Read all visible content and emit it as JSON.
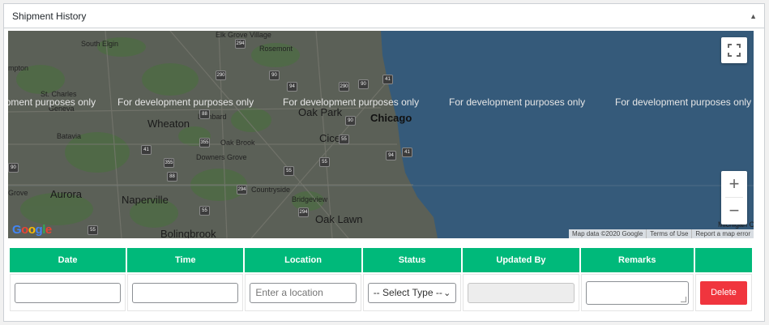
{
  "panel": {
    "title": "Shipment History",
    "toggle_icon": "arrow-up-icon"
  },
  "map": {
    "dev_watermark": "For development purposes only",
    "places": {
      "elk_grove_village": "Elk Grove Village",
      "rosemont": "Rosemont",
      "south_elgin": "South Elgin",
      "hampton": "mpton",
      "st_charles": "St. Charles",
      "geneva": "Geneva",
      "wheaton": "Wheaton",
      "lombard": "Lombard",
      "oak_park": "Oak Park",
      "chicago": "Chicago",
      "cicero": "Cicero",
      "batavia": "Batavia",
      "oak_brook": "Oak Brook",
      "downers_grove": "Downers Grove",
      "countryside": "Countryside",
      "grove": "Grove",
      "aurora": "Aurora",
      "naperville": "Naperville",
      "bridgeview": "Bridgeview",
      "oak_lawn": "Oak Lawn",
      "bolingbrook": "Bolingbrook",
      "michigan_c": "Michigan C"
    },
    "shields": [
      "290",
      "294",
      "90",
      "41",
      "90",
      "290",
      "94",
      "355",
      "88",
      "55",
      "41",
      "94",
      "90",
      "55",
      "55",
      "294",
      "294",
      "355",
      "55",
      "55",
      "41",
      "88",
      "90"
    ],
    "attribution": {
      "map_data": "Map data ©2020 Google",
      "terms": "Terms of Use",
      "report": "Report a map error"
    },
    "google_logo": "Google",
    "controls": {
      "zoom_in": "+",
      "zoom_out": "−"
    }
  },
  "table": {
    "headers": [
      "Date",
      "Time",
      "Location",
      "Status",
      "Updated By",
      "Remarks",
      ""
    ],
    "row": {
      "date": "",
      "time": "",
      "location_placeholder": "Enter a location",
      "status_selected": "-- Select Type --",
      "updated_by": "",
      "remarks": "",
      "delete_label": "Delete"
    }
  },
  "colors": {
    "header_green": "#00b97a",
    "delete_red": "#f0353e",
    "lake_blue": "#355a7a"
  }
}
